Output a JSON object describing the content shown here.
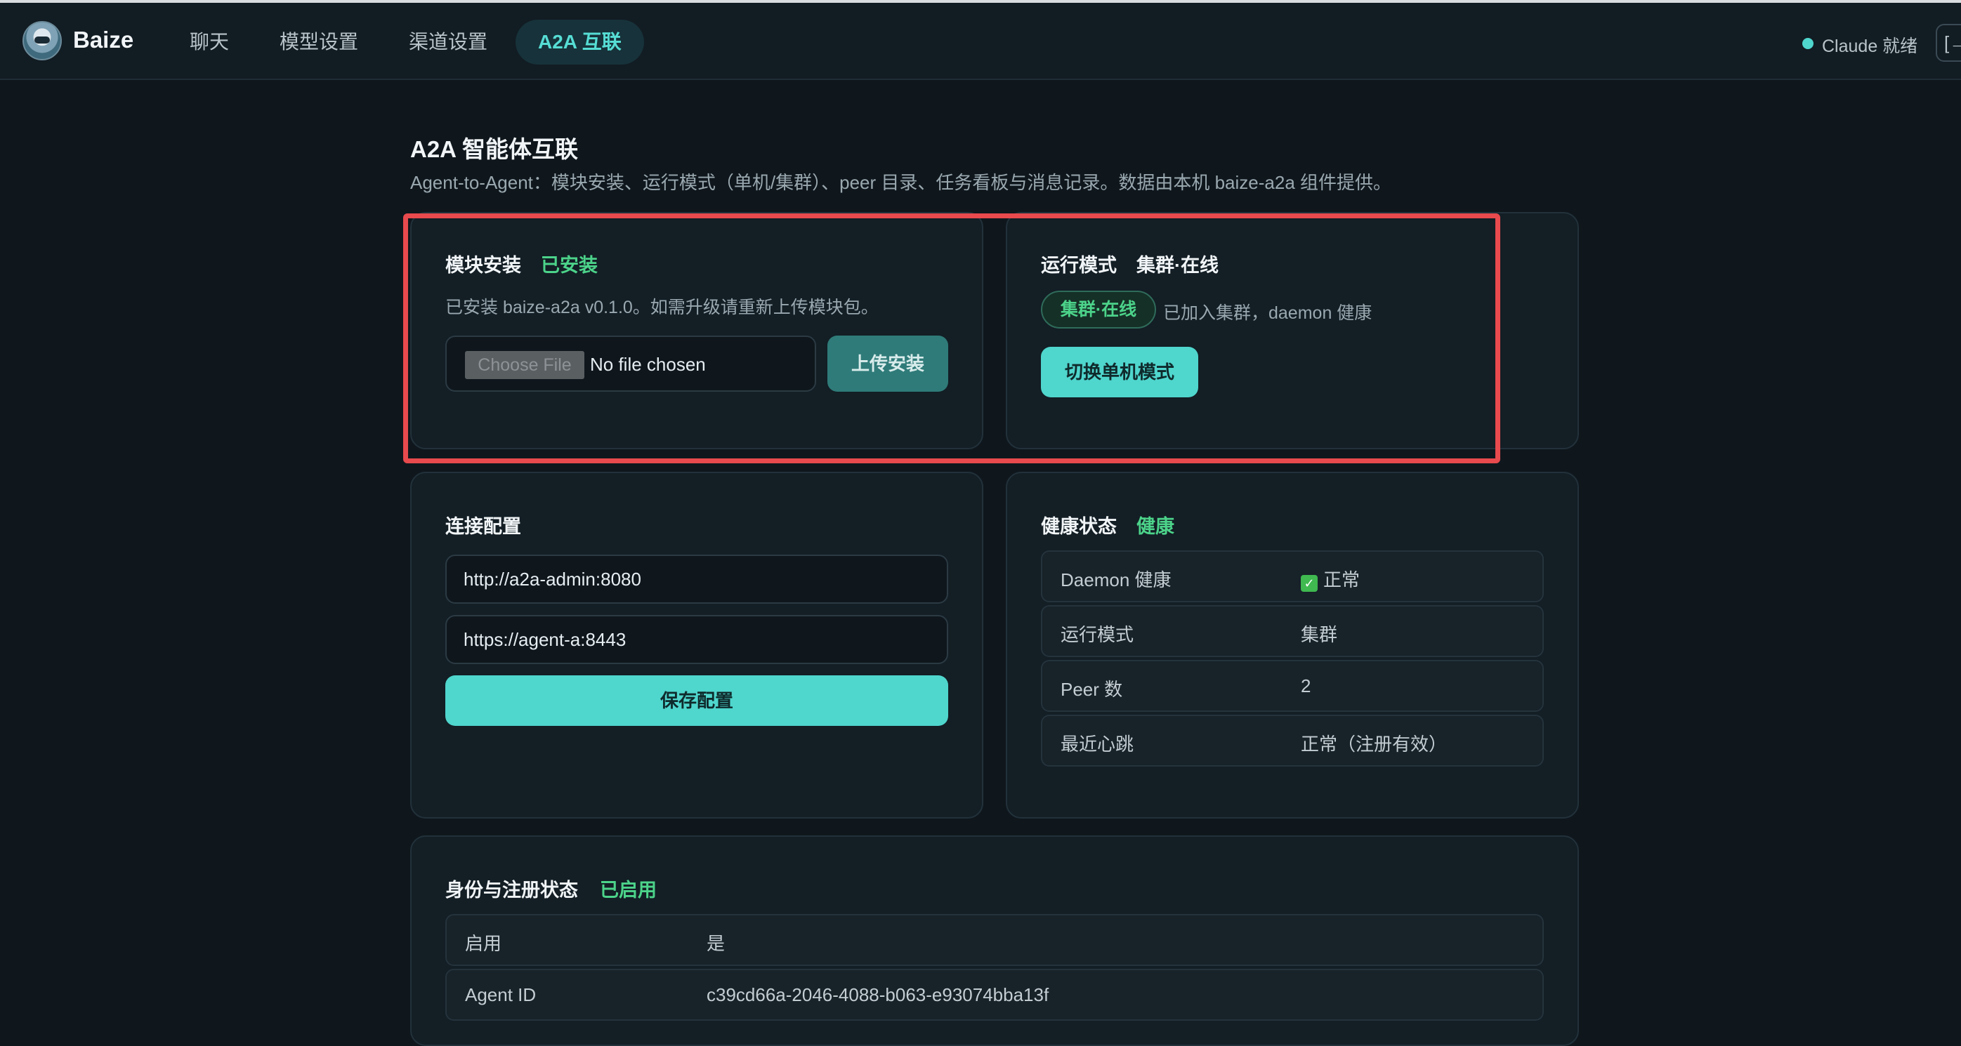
{
  "header": {
    "brand": "Baize",
    "nav": [
      {
        "label": "聊天"
      },
      {
        "label": "模型设置"
      },
      {
        "label": "渠道设置"
      },
      {
        "label": "A2A 互联"
      }
    ],
    "status_text": "Claude 就绪"
  },
  "page": {
    "title": "A2A 智能体互联",
    "subtitle": "Agent-to-Agent：模块安装、运行模式（单机/集群）、peer 目录、任务看板与消息记录。数据由本机 baize-a2a 组件提供。"
  },
  "module": {
    "title": "模块安装",
    "status": "已安装",
    "description": "已安装 baize-a2a v0.1.0。如需升级请重新上传模块包。",
    "choose_file_label": "Choose File",
    "file_status": "No file chosen",
    "upload_label": "上传安装"
  },
  "mode": {
    "title": "运行模式",
    "value": "集群·在线",
    "pill": "集群·在线",
    "description": "已加入集群，daemon 健康",
    "switch_label": "切换单机模式"
  },
  "connection": {
    "title": "连接配置",
    "admin_url": "http://a2a-admin:8080",
    "agent_url": "https://agent-a:8443",
    "save_label": "保存配置"
  },
  "health": {
    "title": "健康状态",
    "status": "健康",
    "rows": [
      {
        "key": "Daemon 健康",
        "value": "正常"
      },
      {
        "key": "运行模式",
        "value": "集群"
      },
      {
        "key": "Peer 数",
        "value": "2"
      },
      {
        "key": "最近心跳",
        "value": "正常（注册有效）"
      }
    ]
  },
  "identity": {
    "title": "身份与注册状态",
    "status": "已启用",
    "rows": [
      {
        "key": "启用",
        "value": "是"
      },
      {
        "key": "Agent ID",
        "value": "c39cd66a-2046-4088-b063-e93074bba13f"
      }
    ]
  },
  "colors": {
    "accent": "#4fd6cd",
    "success": "#4cd38a",
    "highlight": "#e84a4d",
    "background": "#0f171d"
  }
}
